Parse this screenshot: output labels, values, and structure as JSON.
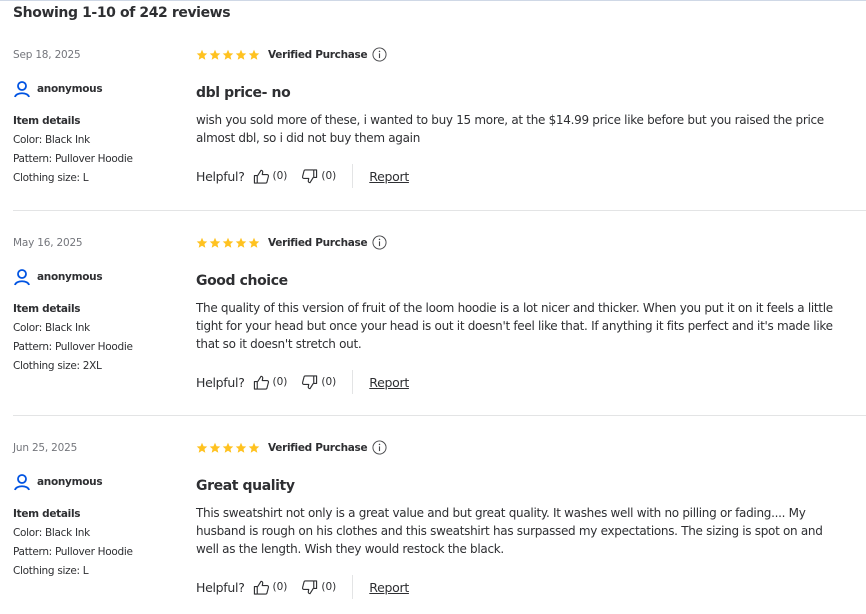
{
  "header": {
    "showing": "Showing 1-10 of 242 reviews"
  },
  "colors": {
    "star": "#ffc220",
    "text": "#2e2f32",
    "user_icon": "#0053e2"
  },
  "labels": {
    "verified": "Verified Purchase",
    "helpful": "Helpful?",
    "report": "Report",
    "item_details": "Item details"
  },
  "reviews": [
    {
      "date": "Sep 18, 2025",
      "user": "anonymous",
      "rating": 5,
      "details": [
        "Color: Black Ink",
        "Pattern: Pullover Hoodie",
        "Clothing size: L"
      ],
      "title": "dbl price- no",
      "text": "wish you sold more of these, i wanted to buy 15 more, at the $14.99 price like before but you raised the price almost dbl, so i did not buy them again",
      "helpful_count": "(0)",
      "unhelpful_count": "(0)"
    },
    {
      "date": "May 16, 2025",
      "user": "anonymous",
      "rating": 5,
      "details": [
        "Color: Black Ink",
        "Pattern: Pullover Hoodie",
        "Clothing size: 2XL"
      ],
      "title": "Good choice",
      "text": "The quality of this version of fruit of the loom hoodie is a lot nicer and thicker. When you put it on it feels a little tight for your head but once your head is out it doesn't feel like that. If anything it fits perfect and it's made like that so it doesn't stretch out.",
      "helpful_count": "(0)",
      "unhelpful_count": "(0)"
    },
    {
      "date": "Jun 25, 2025",
      "user": "anonymous",
      "rating": 5,
      "details": [
        "Color: Black Ink",
        "Pattern: Pullover Hoodie",
        "Clothing size: L"
      ],
      "title": "Great quality",
      "text": "This sweatshirt not only is a great value and but great quality. It washes well with no pilling or fading.... My husband is rough on his clothes and this sweatshirt has surpassed my expectations. The sizing is spot on and well as the length. Wish they would restock the black.",
      "helpful_count": "(0)",
      "unhelpful_count": "(0)"
    }
  ]
}
